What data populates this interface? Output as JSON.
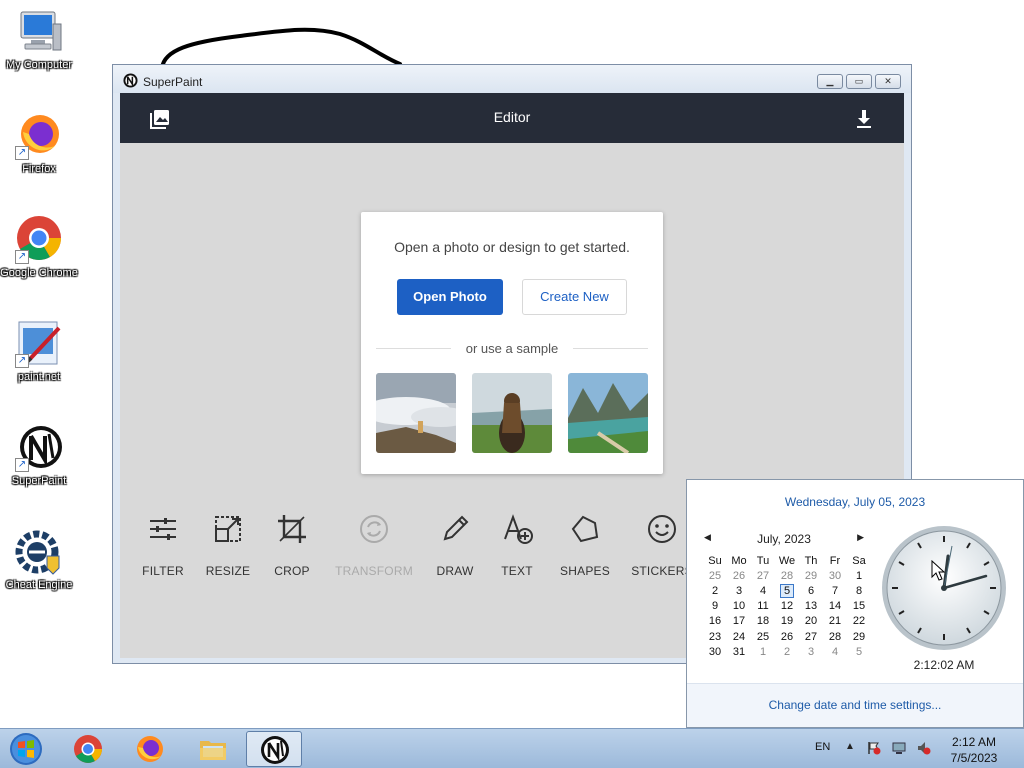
{
  "desktop": {
    "icons": [
      {
        "label": "My Computer",
        "icon": "computer-icon"
      },
      {
        "label": "Firefox",
        "icon": "firefox-icon"
      },
      {
        "label": "Google Chrome",
        "icon": "chrome-icon"
      },
      {
        "label": "paint.net",
        "icon": "paintnet-icon"
      },
      {
        "label": "SuperPaint",
        "icon": "superpaint-icon"
      },
      {
        "label": "Cheat Engine",
        "icon": "cheat-engine-icon"
      }
    ]
  },
  "window": {
    "title": "SuperPaint",
    "header_title": "Editor",
    "card": {
      "prompt": "Open a photo or design to get started.",
      "open_button": "Open Photo",
      "create_button": "Create New",
      "sample_divider": "or use a sample",
      "samples": [
        "sample-fog-landscape",
        "sample-woman-field",
        "sample-lake-mountains"
      ]
    },
    "tools": [
      {
        "label": "FILTER",
        "icon": "sliders-icon",
        "enabled": true
      },
      {
        "label": "RESIZE",
        "icon": "resize-icon",
        "enabled": true
      },
      {
        "label": "CROP",
        "icon": "crop-icon",
        "enabled": true
      },
      {
        "label": "TRANSFORM",
        "icon": "transform-icon",
        "enabled": false
      },
      {
        "label": "DRAW",
        "icon": "pencil-icon",
        "enabled": true
      },
      {
        "label": "TEXT",
        "icon": "text-add-icon",
        "enabled": true
      },
      {
        "label": "SHAPES",
        "icon": "shapes-icon",
        "enabled": true
      },
      {
        "label": "STICKERS",
        "icon": "smiley-icon",
        "enabled": true
      }
    ]
  },
  "calendar": {
    "long_date": "Wednesday, July 05, 2023",
    "month_label": "July, 2023",
    "weekdays": [
      "Su",
      "Mo",
      "Tu",
      "We",
      "Th",
      "Fr",
      "Sa"
    ],
    "weeks": [
      [
        "25",
        "26",
        "27",
        "28",
        "29",
        "30",
        "1"
      ],
      [
        "2",
        "3",
        "4",
        "5",
        "6",
        "7",
        "8"
      ],
      [
        "9",
        "10",
        "11",
        "12",
        "13",
        "14",
        "15"
      ],
      [
        "16",
        "17",
        "18",
        "19",
        "20",
        "21",
        "22"
      ],
      [
        "23",
        "24",
        "25",
        "26",
        "27",
        "28",
        "29"
      ],
      [
        "30",
        "31",
        "1",
        "2",
        "3",
        "4",
        "5"
      ]
    ],
    "today": "5",
    "clock_time": "2:12:02 AM",
    "settings_link": "Change date and time settings..."
  },
  "taskbar": {
    "language": "EN",
    "time": "2:12 AM",
    "date": "7/5/2023"
  }
}
